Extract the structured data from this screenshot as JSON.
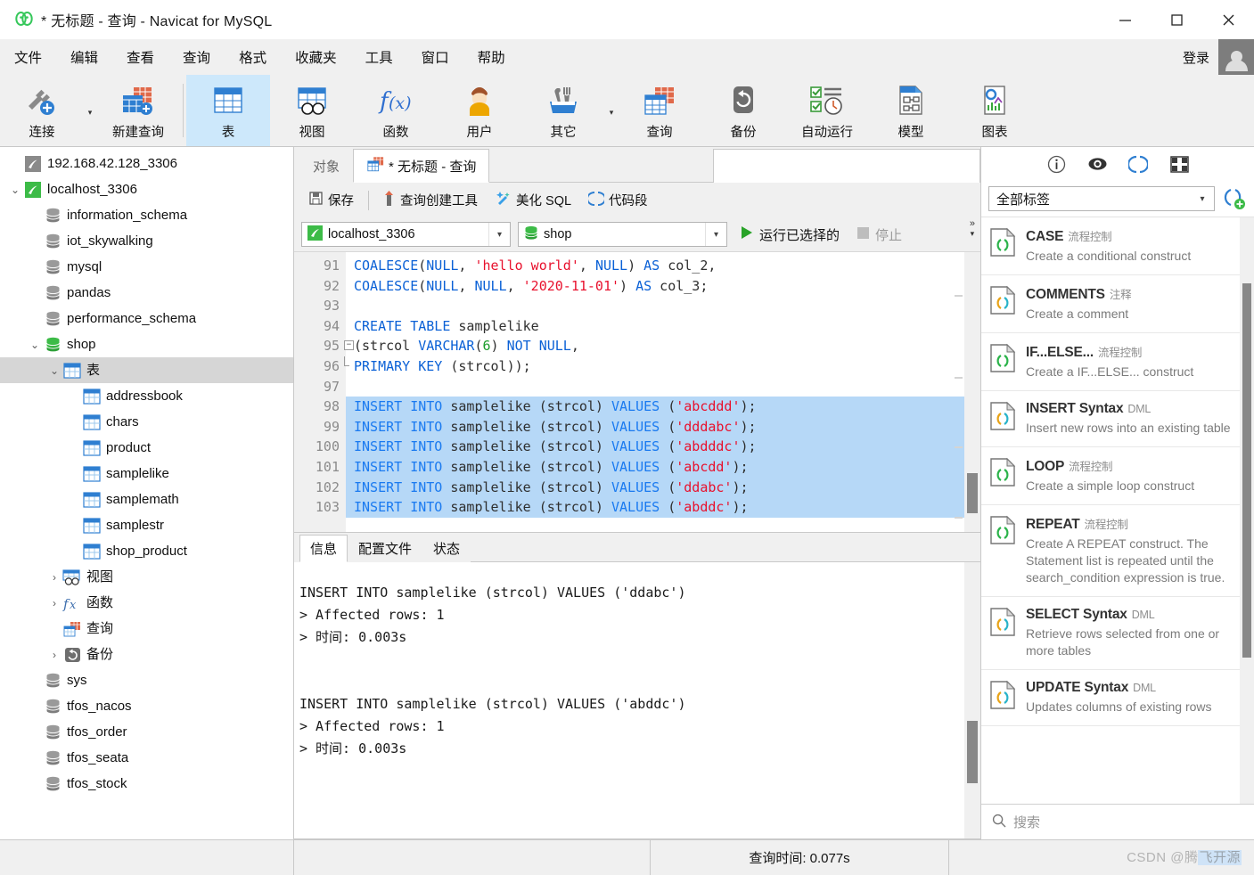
{
  "window": {
    "title": "* 无标题 - 查询 - Navicat for MySQL",
    "minimize": "—",
    "maximize": "▢",
    "close": "✕"
  },
  "menubar": {
    "items": [
      "文件",
      "编辑",
      "查看",
      "查询",
      "格式",
      "收藏夹",
      "工具",
      "窗口",
      "帮助"
    ],
    "login_label": "登录",
    "avatar": "avatar-icon"
  },
  "ribbon": {
    "items": [
      {
        "label": "连接",
        "icon": "connection-icon",
        "selected": false,
        "caret": true
      },
      {
        "label": "新建查询",
        "icon": "new-query-icon",
        "selected": false,
        "caret": false
      },
      {
        "label": "表",
        "icon": "table-icon",
        "selected": true,
        "caret": false
      },
      {
        "label": "视图",
        "icon": "view-icon",
        "selected": false,
        "caret": false
      },
      {
        "label": "函数",
        "icon": "function-icon",
        "selected": false,
        "caret": false
      },
      {
        "label": "用户",
        "icon": "user-icon",
        "selected": false,
        "caret": false
      },
      {
        "label": "其它",
        "icon": "others-icon",
        "selected": false,
        "caret": true
      },
      {
        "label": "查询",
        "icon": "query-icon",
        "selected": false,
        "caret": false
      },
      {
        "label": "备份",
        "icon": "backup-icon",
        "selected": false,
        "caret": false
      },
      {
        "label": "自动运行",
        "icon": "automation-icon",
        "selected": false,
        "caret": false
      },
      {
        "label": "模型",
        "icon": "model-icon",
        "selected": false,
        "caret": false
      },
      {
        "label": "图表",
        "icon": "chart-icon",
        "selected": false,
        "caret": false
      }
    ]
  },
  "tree": [
    {
      "label": "192.168.42.128_3306",
      "icon": "connection-gray-icon",
      "depth": 0,
      "chev": "",
      "selected": false
    },
    {
      "label": "localhost_3306",
      "icon": "connection-green-icon",
      "depth": 0,
      "chev": "v",
      "selected": false
    },
    {
      "label": "information_schema",
      "icon": "database-gray-icon",
      "depth": 1,
      "chev": "",
      "selected": false
    },
    {
      "label": "iot_skywalking",
      "icon": "database-gray-icon",
      "depth": 1,
      "chev": "",
      "selected": false
    },
    {
      "label": "mysql",
      "icon": "database-gray-icon",
      "depth": 1,
      "chev": "",
      "selected": false
    },
    {
      "label": "pandas",
      "icon": "database-gray-icon",
      "depth": 1,
      "chev": "",
      "selected": false
    },
    {
      "label": "performance_schema",
      "icon": "database-gray-icon",
      "depth": 1,
      "chev": "",
      "selected": false
    },
    {
      "label": "shop",
      "icon": "database-green-icon",
      "depth": 1,
      "chev": "v",
      "selected": false
    },
    {
      "label": "表",
      "icon": "table-icon",
      "depth": 2,
      "chev": "v",
      "selected": true
    },
    {
      "label": "addressbook",
      "icon": "table-small-icon",
      "depth": 3,
      "chev": "",
      "selected": false
    },
    {
      "label": "chars",
      "icon": "table-small-icon",
      "depth": 3,
      "chev": "",
      "selected": false
    },
    {
      "label": "product",
      "icon": "table-small-icon",
      "depth": 3,
      "chev": "",
      "selected": false
    },
    {
      "label": "samplelike",
      "icon": "table-small-icon",
      "depth": 3,
      "chev": "",
      "selected": false
    },
    {
      "label": "samplemath",
      "icon": "table-small-icon",
      "depth": 3,
      "chev": "",
      "selected": false
    },
    {
      "label": "samplestr",
      "icon": "table-small-icon",
      "depth": 3,
      "chev": "",
      "selected": false
    },
    {
      "label": "shop_product",
      "icon": "table-small-icon",
      "depth": 3,
      "chev": "",
      "selected": false
    },
    {
      "label": "视图",
      "icon": "view-icon",
      "depth": 2,
      "chev": ">",
      "selected": false
    },
    {
      "label": "函数",
      "icon": "function-icon",
      "depth": 2,
      "chev": ">",
      "selected": false
    },
    {
      "label": "查询",
      "icon": "query-icon",
      "depth": 2,
      "chev": "",
      "selected": false
    },
    {
      "label": "备份",
      "icon": "backup-icon",
      "depth": 2,
      "chev": ">",
      "selected": false
    },
    {
      "label": "sys",
      "icon": "database-gray-icon",
      "depth": 1,
      "chev": "",
      "selected": false
    },
    {
      "label": "tfos_nacos",
      "icon": "database-gray-icon",
      "depth": 1,
      "chev": "",
      "selected": false
    },
    {
      "label": "tfos_order",
      "icon": "database-gray-icon",
      "depth": 1,
      "chev": "",
      "selected": false
    },
    {
      "label": "tfos_seata",
      "icon": "database-gray-icon",
      "depth": 1,
      "chev": "",
      "selected": false
    },
    {
      "label": "tfos_stock",
      "icon": "database-gray-icon",
      "depth": 1,
      "chev": "",
      "selected": false
    }
  ],
  "tabs": {
    "object_tab": "对象",
    "query_tab": "* 无标题 - 查询"
  },
  "editor_toolbar": {
    "save": "保存",
    "query_builder": "查询创建工具",
    "beautify": "美化 SQL",
    "snippet": "代码段"
  },
  "connbar": {
    "connection": "localhost_3306",
    "database": "shop",
    "run_selected": "运行已选择的",
    "stop": "停止"
  },
  "editor": {
    "lines": [
      {
        "n": "91",
        "fold": "",
        "tokens": [
          {
            "t": "COALESCE",
            "c": "kw"
          },
          {
            "t": "(",
            "c": "pl"
          },
          {
            "t": "NULL",
            "c": "kw"
          },
          {
            "t": ", ",
            "c": "pl"
          },
          {
            "t": "'hello world'",
            "c": "str"
          },
          {
            "t": ", ",
            "c": "pl"
          },
          {
            "t": "NULL",
            "c": "kw"
          },
          {
            "t": ") ",
            "c": "pl"
          },
          {
            "t": "AS",
            "c": "kw"
          },
          {
            "t": " col_2,",
            "c": "pl"
          }
        ]
      },
      {
        "n": "92",
        "fold": "",
        "tokens": [
          {
            "t": "COALESCE",
            "c": "kw"
          },
          {
            "t": "(",
            "c": "pl"
          },
          {
            "t": "NULL",
            "c": "kw"
          },
          {
            "t": ", ",
            "c": "pl"
          },
          {
            "t": "NULL",
            "c": "kw"
          },
          {
            "t": ", ",
            "c": "pl"
          },
          {
            "t": "'2020-11-01'",
            "c": "str"
          },
          {
            "t": ") ",
            "c": "pl"
          },
          {
            "t": "AS",
            "c": "kw"
          },
          {
            "t": " col_3;",
            "c": "pl"
          }
        ]
      },
      {
        "n": "93",
        "fold": "",
        "tokens": []
      },
      {
        "n": "94",
        "fold": "",
        "tokens": [
          {
            "t": "CREATE TABLE",
            "c": "kw"
          },
          {
            "t": " samplelike",
            "c": "pl"
          }
        ]
      },
      {
        "n": "95",
        "fold": "start",
        "tokens": [
          {
            "t": "(strcol ",
            "c": "pl"
          },
          {
            "t": "VARCHAR",
            "c": "kw"
          },
          {
            "t": "(",
            "c": "pl"
          },
          {
            "t": "6",
            "c": "num"
          },
          {
            "t": ") ",
            "c": "pl"
          },
          {
            "t": "NOT NULL",
            "c": "kw"
          },
          {
            "t": ",",
            "c": "pl"
          }
        ]
      },
      {
        "n": "96",
        "fold": "end",
        "tokens": [
          {
            "t": "PRIMARY KEY",
            "c": "kw"
          },
          {
            "t": " (strcol));",
            "c": "pl"
          }
        ]
      },
      {
        "n": "97",
        "fold": "",
        "tokens": []
      },
      {
        "n": "98",
        "fold": "",
        "hl": true,
        "tokens": [
          {
            "t": "INSERT INTO",
            "c": "kw2"
          },
          {
            "t": " samplelike (strcol) ",
            "c": "pl"
          },
          {
            "t": "VALUES",
            "c": "kw2"
          },
          {
            "t": " (",
            "c": "pl"
          },
          {
            "t": "'abcddd'",
            "c": "str"
          },
          {
            "t": ");",
            "c": "pl"
          }
        ]
      },
      {
        "n": "99",
        "fold": "",
        "hl": true,
        "tokens": [
          {
            "t": "INSERT INTO",
            "c": "kw2"
          },
          {
            "t": " samplelike (strcol) ",
            "c": "pl"
          },
          {
            "t": "VALUES",
            "c": "kw2"
          },
          {
            "t": " (",
            "c": "pl"
          },
          {
            "t": "'dddabc'",
            "c": "str"
          },
          {
            "t": ");",
            "c": "pl"
          }
        ]
      },
      {
        "n": "100",
        "fold": "",
        "hl": true,
        "tokens": [
          {
            "t": "INSERT INTO",
            "c": "kw2"
          },
          {
            "t": " samplelike (strcol) ",
            "c": "pl"
          },
          {
            "t": "VALUES",
            "c": "kw2"
          },
          {
            "t": " (",
            "c": "pl"
          },
          {
            "t": "'abdddc'",
            "c": "str"
          },
          {
            "t": ");",
            "c": "pl"
          }
        ]
      },
      {
        "n": "101",
        "fold": "",
        "hl": true,
        "tokens": [
          {
            "t": "INSERT INTO",
            "c": "kw2"
          },
          {
            "t": " samplelike (strcol) ",
            "c": "pl"
          },
          {
            "t": "VALUES",
            "c": "kw2"
          },
          {
            "t": " (",
            "c": "pl"
          },
          {
            "t": "'abcdd'",
            "c": "str"
          },
          {
            "t": ");",
            "c": "pl"
          }
        ]
      },
      {
        "n": "102",
        "fold": "",
        "hl": true,
        "tokens": [
          {
            "t": "INSERT INTO",
            "c": "kw2"
          },
          {
            "t": " samplelike (strcol) ",
            "c": "pl"
          },
          {
            "t": "VALUES",
            "c": "kw2"
          },
          {
            "t": " (",
            "c": "pl"
          },
          {
            "t": "'ddabc'",
            "c": "str"
          },
          {
            "t": ");",
            "c": "pl"
          }
        ]
      },
      {
        "n": "103",
        "fold": "",
        "hl": true,
        "tokens": [
          {
            "t": "INSERT INTO",
            "c": "kw2"
          },
          {
            "t": " samplelike (strcol) ",
            "c": "pl"
          },
          {
            "t": "VALUES",
            "c": "kw2"
          },
          {
            "t": " (",
            "c": "pl"
          },
          {
            "t": "'abddc'",
            "c": "str"
          },
          {
            "t": ");",
            "c": "pl"
          }
        ]
      }
    ]
  },
  "results": {
    "tabs": [
      {
        "label": "信息",
        "active": true
      },
      {
        "label": "配置文件",
        "active": false
      },
      {
        "label": "状态",
        "active": false
      }
    ],
    "output": [
      "INSERT INTO samplelike (strcol) VALUES ('ddabc')",
      "> Affected rows: 1",
      "> 时间: 0.003s",
      "",
      "",
      "INSERT INTO samplelike (strcol) VALUES ('abddc')",
      "> Affected rows: 1",
      "> 时间: 0.003s"
    ]
  },
  "right_panel": {
    "icons": [
      "info-icon",
      "eye-icon",
      "snippet-icon",
      "table-grid-icon"
    ],
    "filter_value": "全部标签",
    "add_snippet": "add-snippet-icon",
    "snippets": [
      {
        "title": "CASE",
        "tag": "流程控制",
        "desc": "Create a conditional construct",
        "icon_color": "green"
      },
      {
        "title": "COMMENTS",
        "tag": "注释",
        "desc": "Create a comment",
        "icon_color": "multi"
      },
      {
        "title": "IF...ELSE...",
        "tag": "流程控制",
        "desc": "Create a IF...ELSE... construct",
        "icon_color": "green"
      },
      {
        "title": "INSERT Syntax",
        "tag": "DML",
        "desc": "Insert new rows into an existing table",
        "icon_color": "multi"
      },
      {
        "title": "LOOP",
        "tag": "流程控制",
        "desc": "Create a simple loop construct",
        "icon_color": "green"
      },
      {
        "title": "REPEAT",
        "tag": "流程控制",
        "desc": "Create A REPEAT construct. The Statement list is repeated until the search_condition expression is true.",
        "icon_color": "green"
      },
      {
        "title": "SELECT Syntax",
        "tag": "DML",
        "desc": "Retrieve rows selected from one or more tables",
        "icon_color": "multi"
      },
      {
        "title": "UPDATE Syntax",
        "tag": "DML",
        "desc": "Updates columns of existing rows",
        "icon_color": "multi"
      }
    ],
    "search_placeholder": "搜索"
  },
  "statusbar": {
    "query_time": "查询时间: 0.077s",
    "watermark_prefix": "CSDN @腾",
    "watermark_boxed": "飞开源"
  },
  "colors": {
    "accent_blue": "#2f7fd1",
    "selection": "#b6d8f7",
    "ribbon_selected": "#cde8fb",
    "keyword": "#0b61d6",
    "string": "#e8112d",
    "number": "#1a9c2b",
    "green": "#2ab34a"
  }
}
